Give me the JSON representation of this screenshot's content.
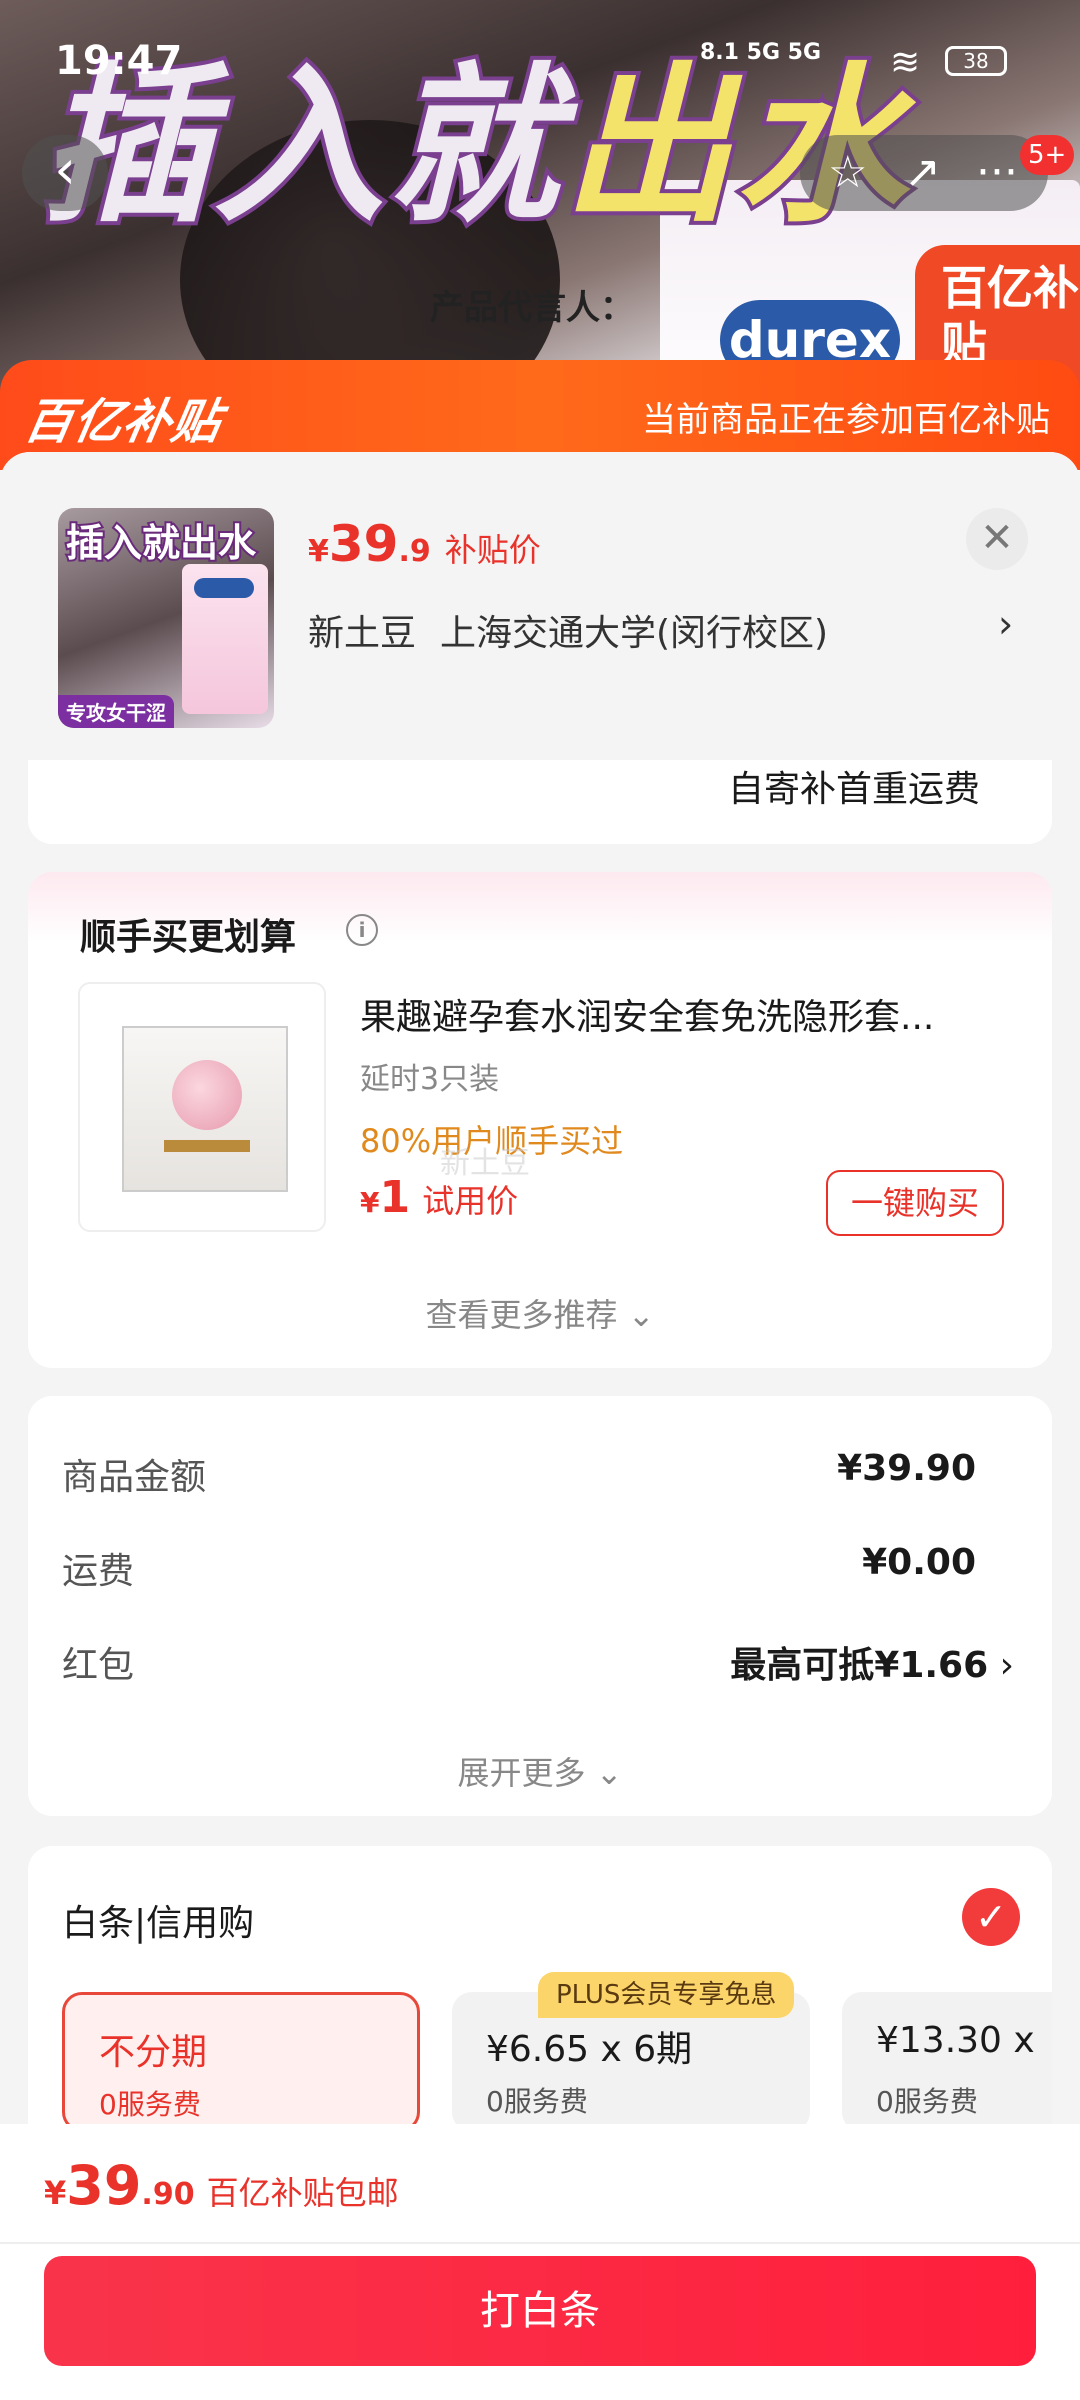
{
  "status_bar": {
    "time": "19:47",
    "signal": "8.1 5G 5G",
    "battery": "38"
  },
  "banner": {
    "headline_a": "插入就",
    "headline_b": "出水",
    "spokesperson": "产品代言人：",
    "brand": "durex",
    "subsidy_tag": "百亿补贴"
  },
  "nav": {
    "badge": "5+"
  },
  "sheet_header": {
    "brand": "百亿补贴",
    "notice": "当前商品正在参加百亿补贴"
  },
  "product": {
    "thumb_title": "插入就出水",
    "thumb_tag": "专攻女干涩",
    "price_currency": "¥",
    "price_int": "39",
    "price_dec": ".9",
    "price_label": "补贴价",
    "address_name": "新土豆",
    "address": "上海交通大学(闵行校区)"
  },
  "shipping_note": "自寄补首重运费",
  "recommend": {
    "title": "顺手买更划算",
    "item": {
      "name": "果趣避孕套水润安全套免洗隐形套...",
      "spec": "延时3只装",
      "popularity": "80%用户顺手买过",
      "price_currency": "¥",
      "price": "1",
      "price_label": "试用价",
      "buy_label": "一键购买"
    },
    "more_label": "查看更多推荐"
  },
  "totals": {
    "rows": [
      {
        "label": "商品金额",
        "value": "¥39.90"
      },
      {
        "label": "运费",
        "value": "¥0.00"
      },
      {
        "label": "红包",
        "value": "最高可抵¥1.66"
      }
    ],
    "more_label": "展开更多"
  },
  "baitiao": {
    "title": "白条|信用购",
    "plus_tag": "PLUS会员专享免息",
    "options": [
      {
        "main": "不分期",
        "fee": "0服务费",
        "selected": true
      },
      {
        "main": "¥6.65 x 6期",
        "fee": "0服务费",
        "selected": false
      },
      {
        "main": "¥13.30 x",
        "fee": "0服务费",
        "selected": false
      }
    ]
  },
  "bottom": {
    "currency": "¥",
    "total_int": "39",
    "total_dec": ".90",
    "total_label": "百亿补贴包邮",
    "pay_label": "打白条"
  },
  "watermark": "新土豆",
  "colors": {
    "accent": "#e8322a",
    "subsidy_orange": "#ff5a1a",
    "plus_gold": "#fcd56a"
  }
}
